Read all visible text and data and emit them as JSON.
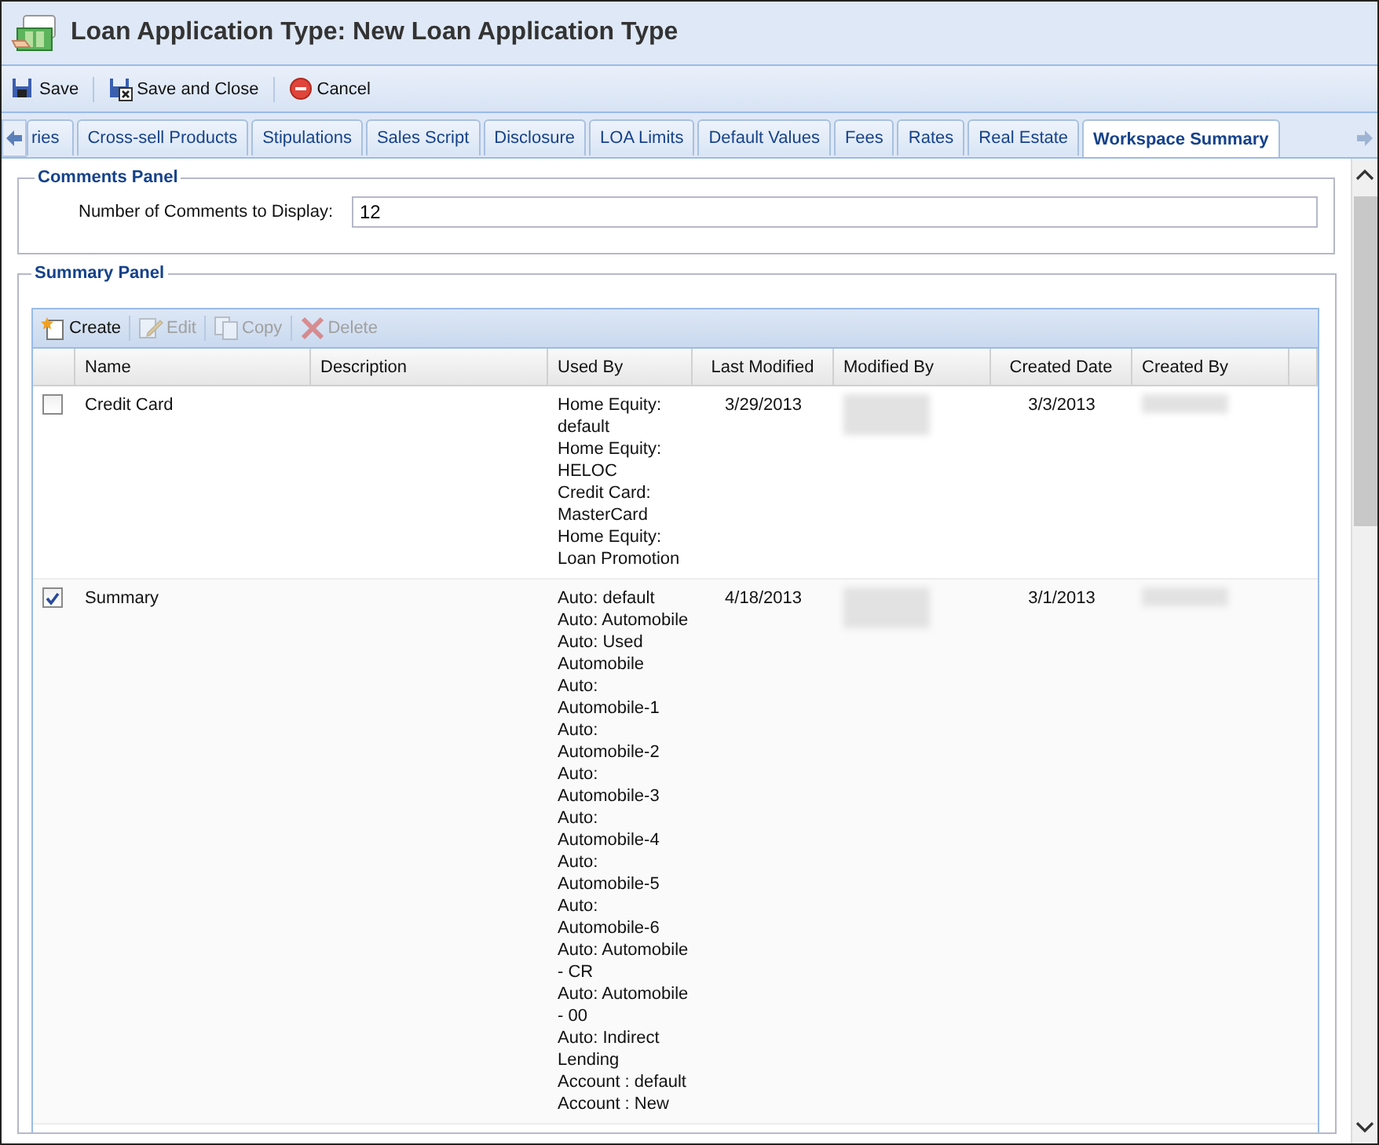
{
  "window": {
    "title": "Loan Application Type: New Loan Application Type"
  },
  "toolbar": [
    {
      "label": "Save",
      "kind": "save"
    },
    {
      "label": "Save and Close",
      "kind": "save-close"
    },
    {
      "label": "Cancel",
      "kind": "cancel"
    }
  ],
  "tabs": [
    {
      "label": "ries",
      "selected": false
    },
    {
      "label": "Cross-sell Products",
      "selected": false
    },
    {
      "label": "Stipulations",
      "selected": false
    },
    {
      "label": "Sales Script",
      "selected": false
    },
    {
      "label": "Disclosure",
      "selected": false
    },
    {
      "label": "LOA Limits",
      "selected": false
    },
    {
      "label": "Default Values",
      "selected": false
    },
    {
      "label": "Fees",
      "selected": false
    },
    {
      "label": "Rates",
      "selected": false
    },
    {
      "label": "Real Estate",
      "selected": false
    },
    {
      "label": "Workspace Summary",
      "selected": true
    }
  ],
  "comments_panel": {
    "title": "Comments Panel",
    "label": "Number of Comments to Display:",
    "value": "12"
  },
  "summary_panel": {
    "title": "Summary Panel",
    "grid_toolbar": [
      {
        "label": "Create",
        "kind": "create",
        "disabled": false
      },
      {
        "label": "Edit",
        "kind": "edit",
        "disabled": true
      },
      {
        "label": "Copy",
        "kind": "copy",
        "disabled": true
      },
      {
        "label": "Delete",
        "kind": "delete",
        "disabled": true
      }
    ],
    "columns": [
      "Name",
      "Description",
      "Used By",
      "Last Modified",
      "Modified By",
      "Created Date",
      "Created By"
    ],
    "rows": [
      {
        "checked": false,
        "name": "Credit Card",
        "used_by": [
          "Home Equity: default",
          "Home Equity: HELOC",
          "Credit Card: MasterCard",
          "Home Equity: Loan Promotion"
        ],
        "last_modified": "3/29/2013",
        "created_date": "3/3/2013"
      },
      {
        "checked": true,
        "name": "Summary",
        "used_by": [
          "Auto: default",
          "Auto: Automobile",
          "Auto: Used Automobile",
          "Auto: Automobile-1",
          "Auto: Automobile-2",
          "Auto: Automobile-3",
          "Auto: Automobile-4",
          "Auto: Automobile-5",
          "Auto: Automobile-6",
          "Auto: Automobile - CR",
          "Auto: Automobile - 00",
          "Auto: Indirect Lending",
          "Account : default",
          "Account : New"
        ],
        "last_modified": "4/18/2013",
        "created_date": "3/1/2013"
      }
    ]
  }
}
